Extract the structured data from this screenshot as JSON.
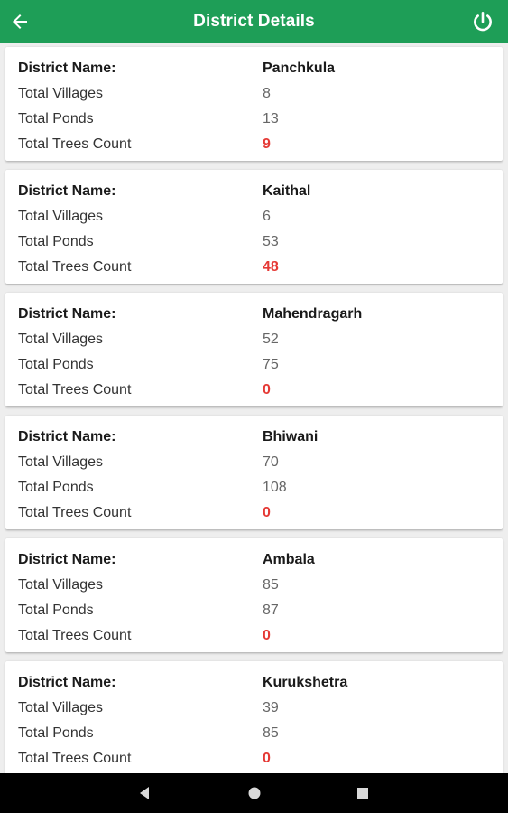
{
  "header": {
    "title": "District Details",
    "back_icon": "arrow-back-icon",
    "power_icon": "power-icon"
  },
  "colors": {
    "primary": "#1e9e57",
    "trees_value": "#e53935"
  },
  "labels": {
    "district_name": "District Name:",
    "total_villages": "Total Villages",
    "total_ponds": "Total Ponds",
    "total_trees": "Total Trees Count"
  },
  "districts": [
    {
      "name": "Panchkula",
      "villages": "8",
      "ponds": "13",
      "trees": "9"
    },
    {
      "name": "Kaithal",
      "villages": "6",
      "ponds": "53",
      "trees": "48"
    },
    {
      "name": "Mahendragarh",
      "villages": "52",
      "ponds": "75",
      "trees": "0"
    },
    {
      "name": "Bhiwani",
      "villages": "70",
      "ponds": "108",
      "trees": "0"
    },
    {
      "name": "Ambala",
      "villages": "85",
      "ponds": "87",
      "trees": "0"
    },
    {
      "name": "Kurukshetra",
      "villages": "39",
      "ponds": "85",
      "trees": "0"
    }
  ],
  "nav": {
    "back": "nav-back-icon",
    "home": "nav-home-icon",
    "recents": "nav-recents-icon"
  }
}
